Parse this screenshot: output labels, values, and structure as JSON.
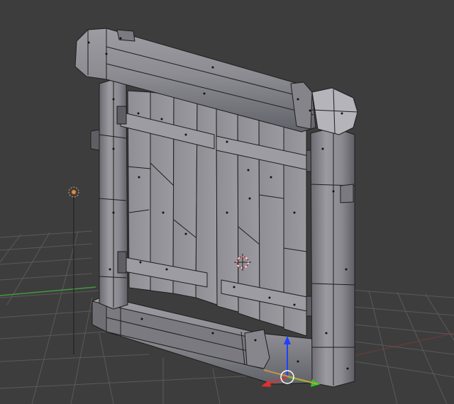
{
  "viewport": {
    "mode": "solid-shading-with-wireframe",
    "background": "#3d3d3d",
    "grid_color": "#5c5c5c",
    "x_axis_color": "#9a3a3a",
    "y_axis_color": "#4f9a4f",
    "mesh_color": "#8d8d92",
    "mesh_shadow_color": "#5a5a60",
    "edge_color": "#1c1c1c",
    "vertex_color": "#111111"
  },
  "scene_objects": {
    "gate_model": "door-frame-mesh",
    "lamp": "lamp-icon",
    "cursor": "3d-cursor-icon",
    "gizmo": {
      "z_color": "#2040ff",
      "y_color": "#30c030",
      "x_color": "#e03030"
    }
  }
}
